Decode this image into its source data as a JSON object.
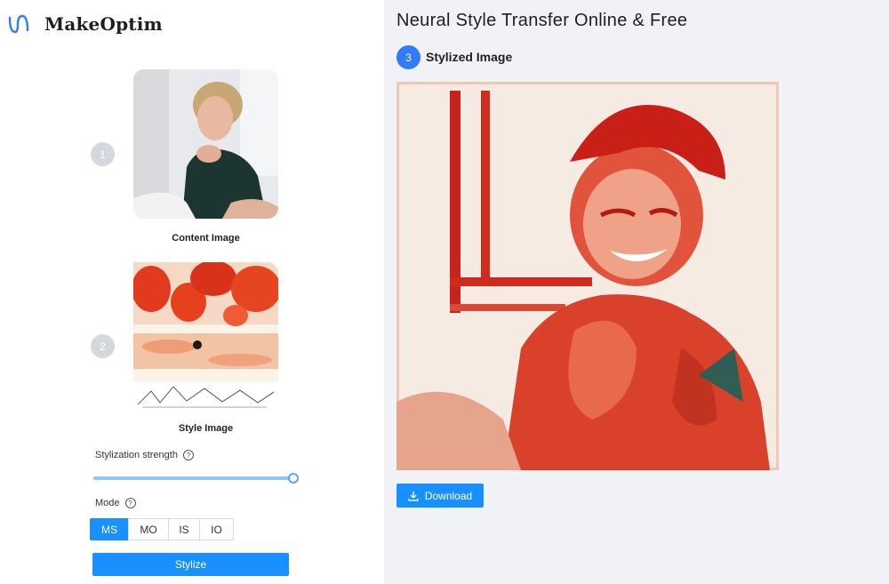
{
  "app": {
    "name": "MakeOptim",
    "brand_color": "#2f7cf6"
  },
  "sidebar": {
    "steps": [
      {
        "number": "1",
        "caption": "Content Image"
      },
      {
        "number": "2",
        "caption": "Style Image"
      }
    ],
    "strength": {
      "label": "Stylization strength",
      "help": "?",
      "value_fraction": 1.0
    },
    "mode": {
      "label": "Mode",
      "help": "?",
      "options": [
        "MS",
        "MO",
        "IS",
        "IO"
      ],
      "selected": "MS"
    },
    "stylize_label": "Stylize"
  },
  "main": {
    "title": "Neural Style Transfer Online & Free",
    "result_step": {
      "number": "3",
      "label": "Stylized Image"
    },
    "download_label": "Download"
  },
  "icons": {
    "logo": "logo-mark-icon",
    "help": "help-icon",
    "download": "download-icon"
  },
  "colors": {
    "primary": "#1890ff",
    "step_inactive": "#d4d7dc",
    "step_active": "#2f7cf6"
  }
}
